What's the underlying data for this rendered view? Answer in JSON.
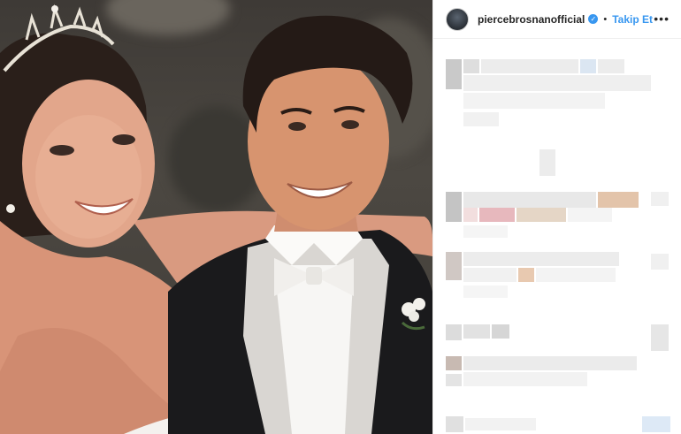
{
  "post": {
    "header": {
      "username": "piercebrosnanofficial",
      "separator": "•",
      "follow_label": "Takip Et",
      "more_icon": "more-horizontal-icon",
      "verified_icon": "verified-badge-icon"
    },
    "colors": {
      "accent": "#3897f0",
      "text": "#262626",
      "border": "#efefef"
    }
  }
}
